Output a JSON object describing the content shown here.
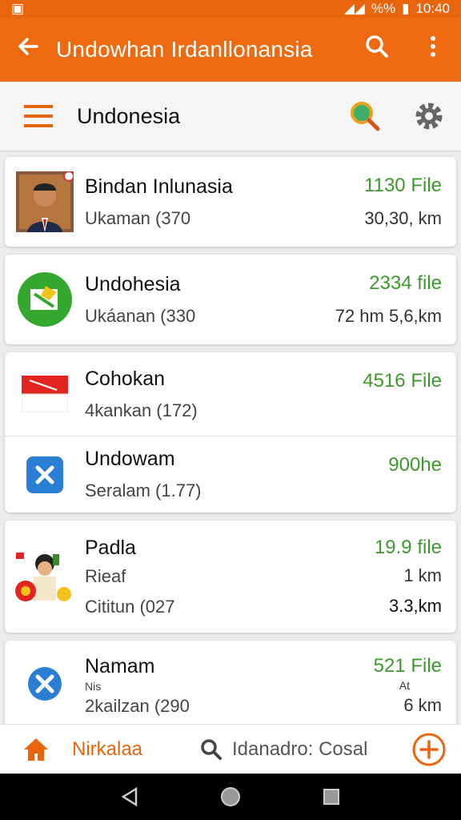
{
  "status": {
    "battery": "%%",
    "time": "10:40"
  },
  "appbar": {
    "title": "Undowhan Irdanllonansia",
    "back_icon": "arrow-left-icon",
    "search_icon": "search-icon",
    "menu_icon": "more-vert-icon"
  },
  "subbar": {
    "title": "Undonesia"
  },
  "items": [
    {
      "name": "Bindan Inlunasia",
      "sub": "Ukaman (370",
      "count": "1130 File",
      "dist": "30,30, km"
    },
    {
      "name": "Undohesia",
      "sub": "Ukáanan (330",
      "count": "2334 file",
      "dist": "72 hm 5,6,km"
    },
    {
      "name": "Cohokan",
      "sub": "4kankan (172)",
      "count": "4516 File",
      "dist": ""
    },
    {
      "name": "Undowam",
      "sub": "Seralam (1.77)",
      "count": "900he",
      "dist": ""
    },
    {
      "name": "Padla",
      "sub": "Rieaf",
      "sub2": "Cititun (027",
      "count": "19.9 file",
      "dist": "1 km",
      "dist2": "3.3,km"
    },
    {
      "name": "Namam",
      "sub": "Nis",
      "sub2": "2kailzan (290",
      "count": "521 File",
      "dist": "At",
      "dist2": "6 km"
    }
  ],
  "bottomnav": {
    "home_label": "Nirkalaa",
    "search_text": "Idanadro: Cosal"
  },
  "colors": {
    "accent": "#ee6a10",
    "green": "#3c9a2c"
  }
}
